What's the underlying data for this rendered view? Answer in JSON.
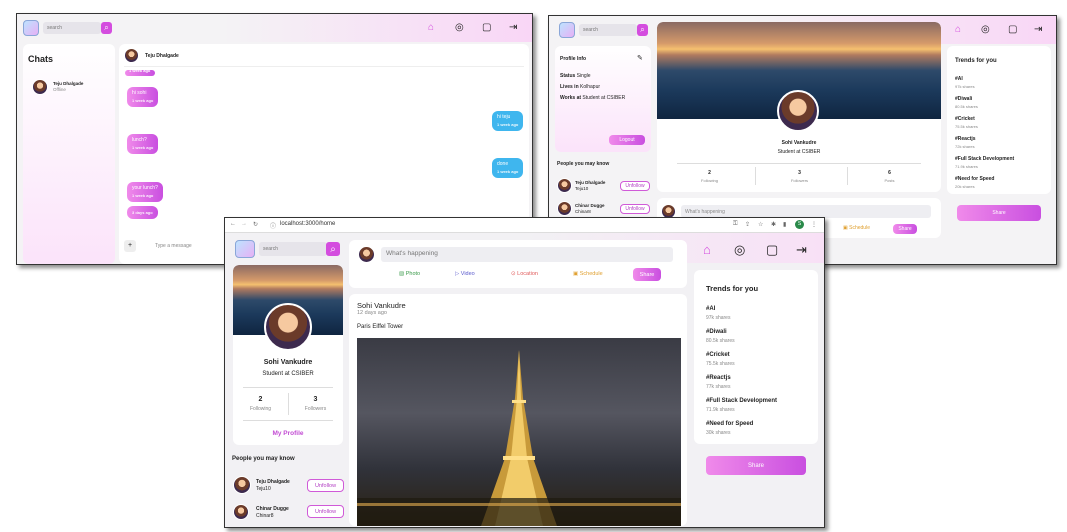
{
  "colors": {
    "accent": "#d44ddf",
    "accent_light": "#f08aea",
    "chat_blue": "#3fb6ee"
  },
  "icons": {
    "home": "home-icon",
    "profile": "user-circle-icon",
    "chat": "message-icon",
    "logout": "logout-icon"
  },
  "chat_screen": {
    "search_placeholder": "search",
    "chats_title": "Chats",
    "contact_name": "Teju Dhalgade",
    "contact_status": "Offline",
    "header_name": "Teju Dhalgade",
    "messages": [
      {
        "text": "hi sohi",
        "time": "1 week ago",
        "side": "left"
      },
      {
        "text": "hi teju",
        "time": "1 week ago",
        "side": "right"
      },
      {
        "text": "lunch?",
        "time": "1 week ago",
        "side": "left"
      },
      {
        "text": "done",
        "time": "1 week ago",
        "side": "right"
      },
      {
        "text": "your lunch?",
        "time": "1 week ago",
        "side": "left"
      },
      {
        "text": "3 days ago",
        "time": "",
        "side": "left"
      }
    ],
    "message_placeholder": "Type a message",
    "top_time": "1 week ago"
  },
  "profile_screen": {
    "search_placeholder": "search",
    "profile_info_title": "Profile Info",
    "status_label": "Status",
    "status_value": "Single",
    "lives_label": "Lives in",
    "lives_value": "Kolhapur",
    "works_label": "Works at",
    "works_value": "Student at CSIBER",
    "logout": "Logout",
    "people_title": "People you may know",
    "people": [
      {
        "name": "Teju Dhalgade",
        "handle": "Teju10",
        "action": "Unfollow"
      },
      {
        "name": "Chinar Dugge",
        "handle": "Chinar8",
        "action": "Unfollow"
      }
    ],
    "name": "Sohi Vankudre",
    "role": "Student at CSIBER",
    "stats": [
      {
        "value": "2",
        "label": "Following"
      },
      {
        "value": "3",
        "label": "Followers"
      },
      {
        "value": "6",
        "label": "Posts"
      }
    ],
    "whats_happening": "What's happening",
    "schedule": "Schedule",
    "share": "Share",
    "trends_title": "Trends for you",
    "trends": [
      {
        "tag": "#AI",
        "count": "97k shares"
      },
      {
        "tag": "#Diwali",
        "count": "80.5k shares"
      },
      {
        "tag": "#Cricket",
        "count": "75.5k shares"
      },
      {
        "tag": "#Reactjs",
        "count": "72k shares"
      },
      {
        "tag": "#Full Stack Development",
        "count": "71.9k shares"
      },
      {
        "tag": "#Need for Speed",
        "count": "20k shares"
      }
    ],
    "share_button": "Share"
  },
  "home_screen": {
    "url": "localhost:3000/home",
    "search_placeholder": "search",
    "name": "Sohi Vankudre",
    "role": "Student at CSIBER",
    "stats": [
      {
        "value": "2",
        "label": "Following"
      },
      {
        "value": "3",
        "label": "Followers"
      }
    ],
    "my_profile": "My Profile",
    "people_title": "People you may know",
    "people": [
      {
        "name": "Teju Dhalgade",
        "handle": "Teju10",
        "action": "Unfollow"
      },
      {
        "name": "Chinar Dugge",
        "handle": "Chinar8",
        "action": "Unfollow"
      }
    ],
    "whats_happening": "What's happening",
    "post_actions": {
      "photo": "Photo",
      "video": "Video",
      "location": "Location",
      "schedule": "Schedule",
      "share": "Share"
    },
    "post": {
      "author": "Sohi Vankudre",
      "time": "12 days ago",
      "caption": "Paris Eiffel Tower"
    },
    "trends_title": "Trends for you",
    "trends": [
      {
        "tag": "#AI",
        "count": "97k shares"
      },
      {
        "tag": "#Diwali",
        "count": "80.5k shares"
      },
      {
        "tag": "#Cricket",
        "count": "75.5k shares"
      },
      {
        "tag": "#Reactjs",
        "count": "77k shares"
      },
      {
        "tag": "#Full Stack Development",
        "count": "71.9k shares"
      },
      {
        "tag": "#Need for Speed",
        "count": "30k shares"
      }
    ],
    "share_button": "Share",
    "browser_avatar_letter": "S"
  }
}
